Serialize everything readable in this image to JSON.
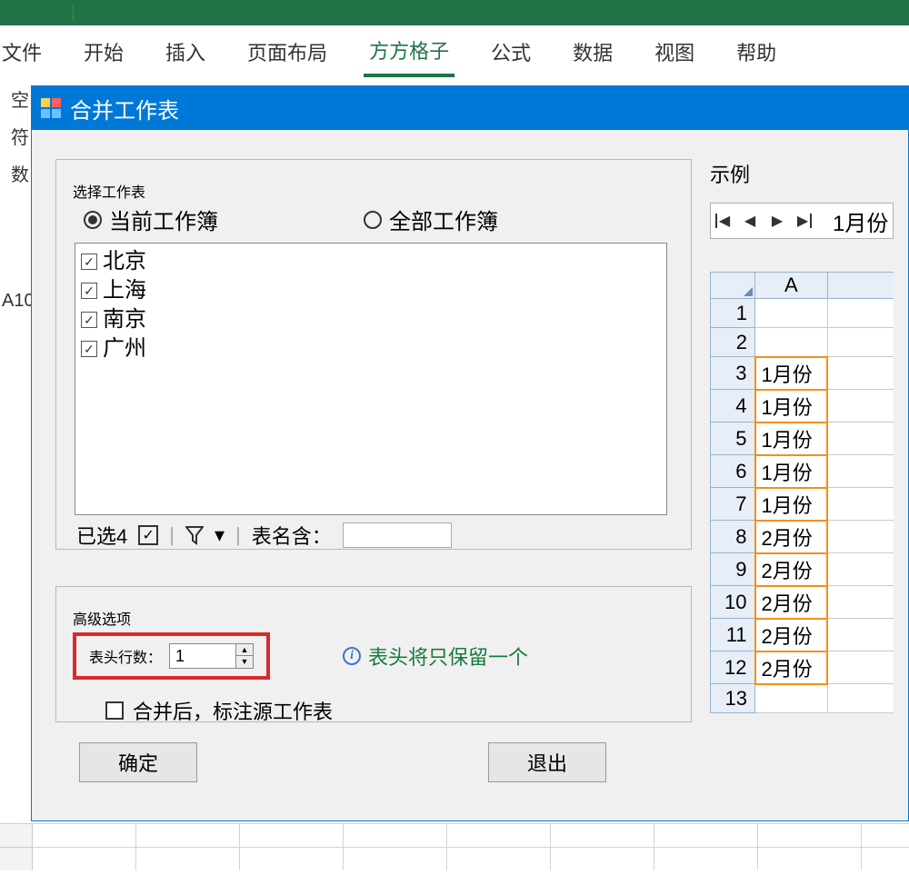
{
  "ribbon": {
    "tabs": [
      "文件",
      "开始",
      "插入",
      "页面布局",
      "方方格子",
      "公式",
      "数据",
      "视图",
      "帮助"
    ],
    "activeIndex": 4
  },
  "leftGutter": [
    "空",
    "符",
    "数"
  ],
  "cellRef": "A10",
  "dialog": {
    "title": "合并工作表",
    "group1": {
      "legend": "选择工作表",
      "radios": {
        "current": "当前工作簿",
        "all": "全部工作簿"
      },
      "items": [
        "北京",
        "上海",
        "南京",
        "广州"
      ],
      "selectedCount": "已选4",
      "nameContains": "表名含：",
      "nameFilterValue": ""
    },
    "group2": {
      "legend": "高级选项",
      "headerRowsLabel": "表头行数：",
      "headerRowsValue": "1",
      "infoText": "表头将只保留一个",
      "markLabel": "合并后，标注源工作表"
    },
    "buttons": {
      "ok": "确定",
      "cancel": "退出"
    }
  },
  "example": {
    "label": "示例",
    "sheetTab": "1月份",
    "colHeader": "A",
    "rows": [
      {
        "n": "1",
        "v": ""
      },
      {
        "n": "2",
        "v": ""
      },
      {
        "n": "3",
        "v": "1月份"
      },
      {
        "n": "4",
        "v": "1月份"
      },
      {
        "n": "5",
        "v": "1月份"
      },
      {
        "n": "6",
        "v": "1月份"
      },
      {
        "n": "7",
        "v": "1月份"
      },
      {
        "n": "8",
        "v": "2月份"
      },
      {
        "n": "9",
        "v": "2月份"
      },
      {
        "n": "10",
        "v": "2月份"
      },
      {
        "n": "11",
        "v": "2月份"
      },
      {
        "n": "12",
        "v": "2月份"
      },
      {
        "n": "13",
        "v": ""
      }
    ]
  }
}
